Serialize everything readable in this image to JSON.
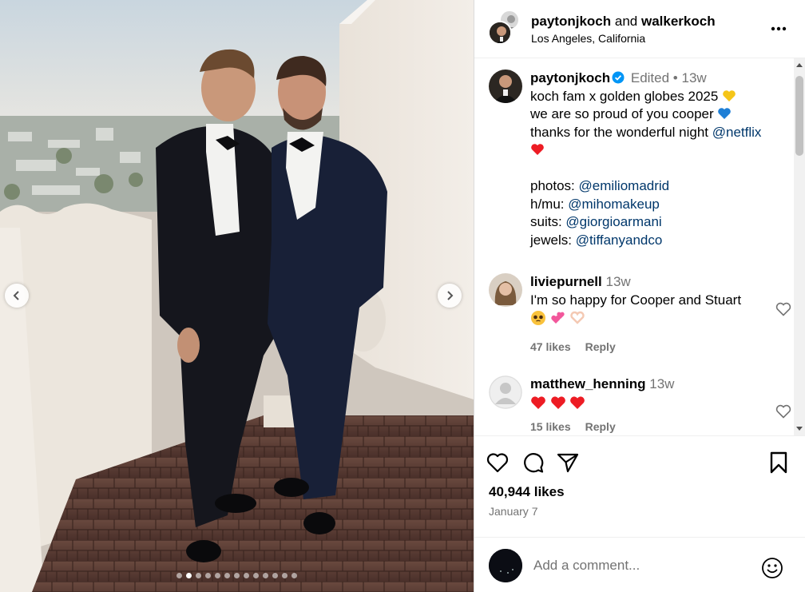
{
  "header": {
    "user1": "paytonjkoch",
    "connector": "and",
    "user2": "walkerkoch",
    "location": "Los Angeles, California"
  },
  "caption": {
    "username": "paytonjkoch",
    "edited": "Edited",
    "separator": "•",
    "time": "13w",
    "line1": "koch fam x golden globes 2025",
    "line2": "we are so proud of you cooper",
    "line3": "thanks for the wonderful night",
    "line3_mention": "@netflix",
    "photos_label": "photos:",
    "photos_mention": "@emiliomadrid",
    "hmu_label": "h/mu:",
    "hmu_mention": "@mihomakeup",
    "suits_label": "suits:",
    "suits_mention": "@giorgioarmani",
    "jewels_label": "jewels:",
    "jewels_mention": "@tiffanyandco"
  },
  "comments": [
    {
      "username": "liviepurnell",
      "time": "13w",
      "text": "I'm so happy for Cooper and Stuart",
      "likes": "47 likes",
      "reply": "Reply"
    },
    {
      "username": "matthew_henning",
      "time": "13w",
      "likes": "15 likes",
      "reply": "Reply"
    }
  ],
  "post": {
    "likes": "40,944 likes",
    "date": "January 7"
  },
  "comment_input": {
    "placeholder": "Add a comment..."
  },
  "carousel": {
    "total_slides": 13,
    "active_index": 1
  },
  "icons": {
    "heart": "heart-icon",
    "comment": "comment-icon",
    "share": "share-icon",
    "save": "bookmark-icon",
    "emoji": "emoji-icon",
    "more": "more-options-icon",
    "verified": "verified-badge-icon"
  },
  "colors": {
    "verified": "#0095f6",
    "mention": "#00376b",
    "muted": "#737373",
    "heart_red": "#ed1c24"
  }
}
